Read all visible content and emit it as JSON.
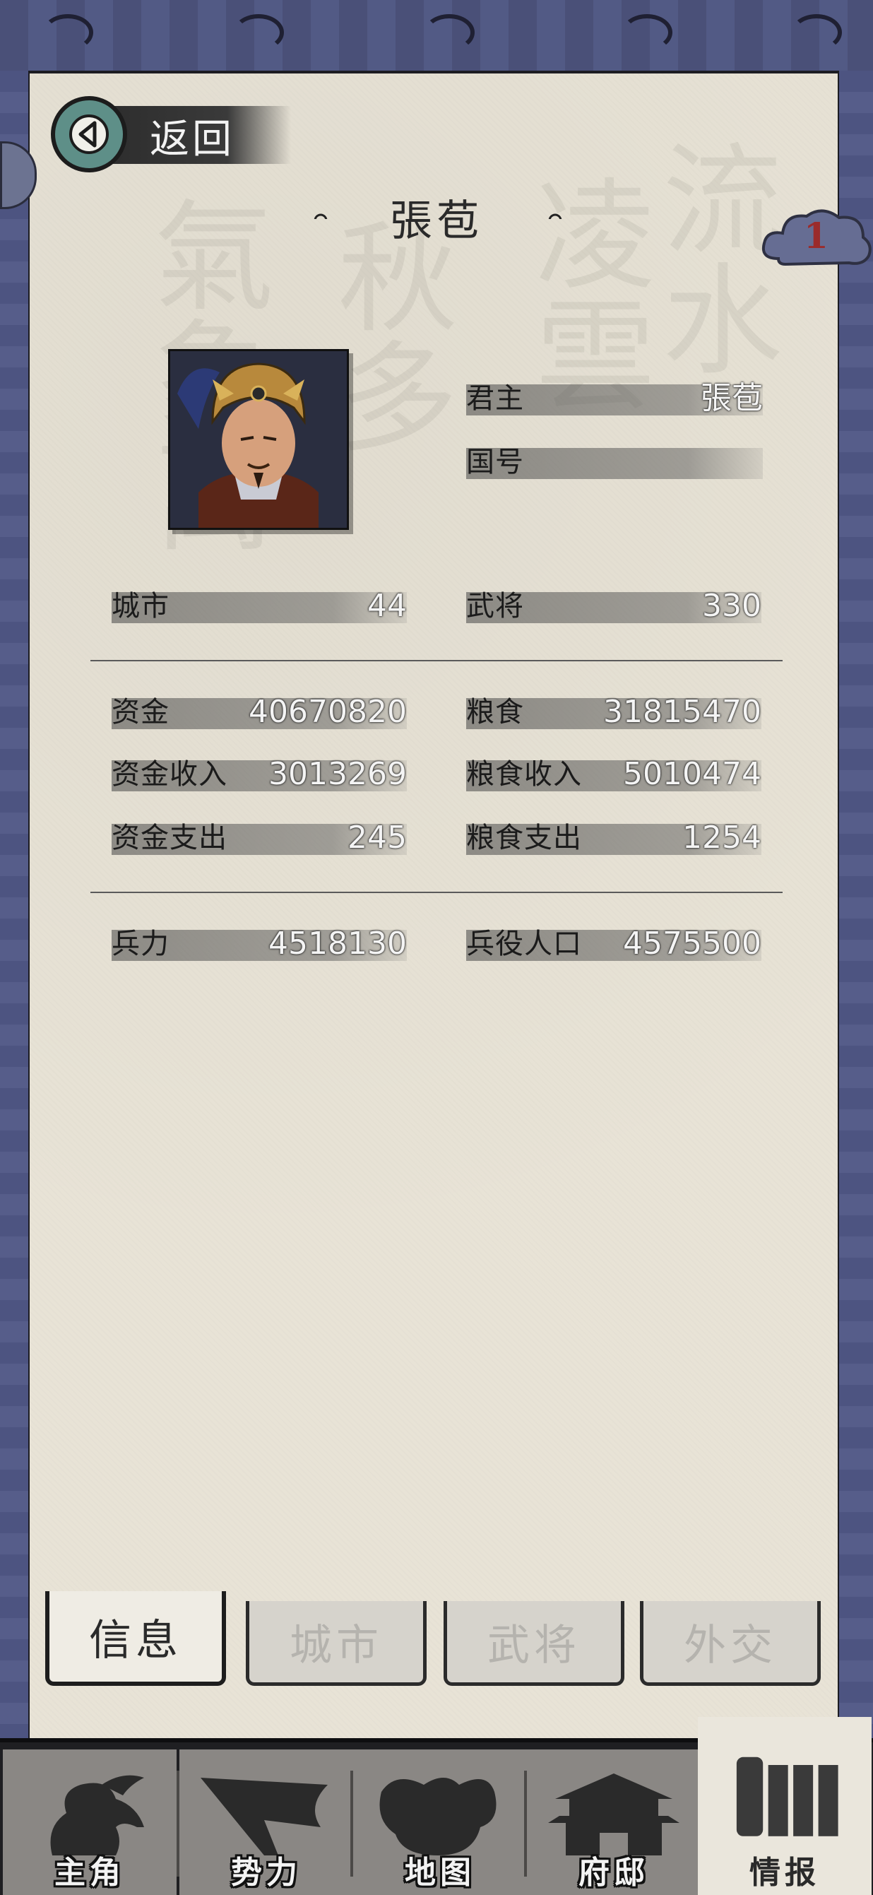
{
  "header": {
    "back_label": "返回",
    "title": "張苞",
    "badge_count": "1"
  },
  "ruler": {
    "fields": [
      {
        "label": "君主",
        "value": "張苞"
      },
      {
        "label": "国号",
        "value": ""
      }
    ]
  },
  "stats": {
    "group1": [
      {
        "label": "城市",
        "value": "44"
      },
      {
        "label": "武将",
        "value": "330"
      }
    ],
    "group2": [
      {
        "label": "资金",
        "value": "40670820"
      },
      {
        "label": "粮食",
        "value": "31815470"
      },
      {
        "label": "资金收入",
        "value": "3013269"
      },
      {
        "label": "粮食收入",
        "value": "5010474"
      },
      {
        "label": "资金支出",
        "value": "245"
      },
      {
        "label": "粮食支出",
        "value": "1254"
      }
    ],
    "group3": [
      {
        "label": "兵力",
        "value": "4518130"
      },
      {
        "label": "兵役人口",
        "value": "4575500"
      }
    ]
  },
  "tabs": [
    {
      "label": "信息",
      "active": true
    },
    {
      "label": "城市",
      "active": false
    },
    {
      "label": "武将",
      "active": false
    },
    {
      "label": "外交",
      "active": false
    }
  ],
  "nav": [
    {
      "label": "主角",
      "icon": "hero-icon"
    },
    {
      "label": "势力",
      "icon": "flag-icon"
    },
    {
      "label": "地图",
      "icon": "map-icon"
    },
    {
      "label": "府邸",
      "icon": "mansion-icon"
    },
    {
      "label": "情报",
      "icon": "scroll-icon",
      "active": true
    }
  ],
  "colors": {
    "accent": "#5e8f88",
    "frame": "#4d5481",
    "paper": "#e8e3d6",
    "badge_num": "#9b2b2b"
  }
}
